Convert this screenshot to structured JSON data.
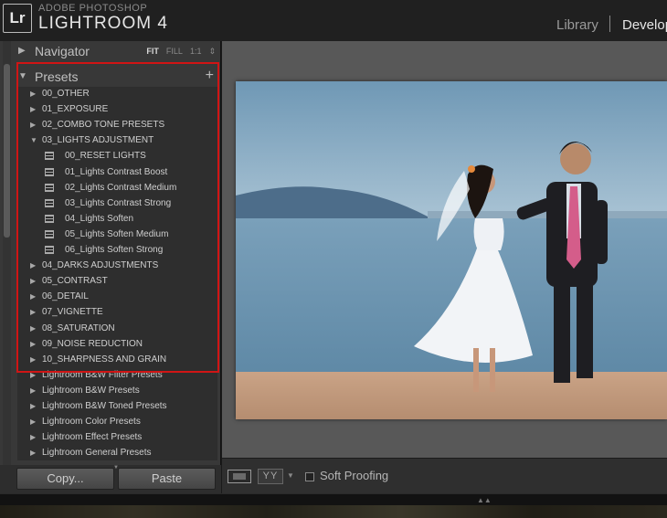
{
  "app": {
    "logo": "Lr",
    "subtitle": "ADOBE PHOTOSHOP",
    "title": "LIGHTROOM 4"
  },
  "modules": {
    "library": "Library",
    "develop": "Develop"
  },
  "navigator": {
    "label": "Navigator",
    "options": [
      "FIT",
      "FILL",
      "1:1"
    ],
    "stepper": "⇕"
  },
  "presets": {
    "label": "Presets",
    "add": "+",
    "folders": [
      {
        "label": "00_OTHER",
        "expanded": false
      },
      {
        "label": "01_EXPOSURE",
        "expanded": false
      },
      {
        "label": "02_COMBO TONE PRESETS",
        "expanded": false
      },
      {
        "label": "03_LIGHTS ADJUSTMENT",
        "expanded": true,
        "children": [
          "00_RESET LIGHTS",
          "01_Lights Contrast Boost",
          "02_Lights Contrast Medium",
          "03_Lights Contrast Strong",
          "04_Lights Soften",
          "05_Lights Soften Medium",
          "06_Lights Soften Strong"
        ]
      },
      {
        "label": "04_DARKS ADJUSTMENTS",
        "expanded": false
      },
      {
        "label": "05_CONTRAST",
        "expanded": false
      },
      {
        "label": "06_DETAIL",
        "expanded": false
      },
      {
        "label": "07_VIGNETTE",
        "expanded": false
      },
      {
        "label": "08_SATURATION",
        "expanded": false
      },
      {
        "label": "09_NOISE REDUCTION",
        "expanded": false
      },
      {
        "label": "10_SHARPNESS AND GRAIN",
        "expanded": false
      },
      {
        "label": "Lightroom B&W Filter Presets",
        "expanded": false
      },
      {
        "label": "Lightroom B&W Presets",
        "expanded": false
      },
      {
        "label": "Lightroom B&W Toned Presets",
        "expanded": false
      },
      {
        "label": "Lightroom Color Presets",
        "expanded": false
      },
      {
        "label": "Lightroom Effect Presets",
        "expanded": false
      },
      {
        "label": "Lightroom General Presets",
        "expanded": false
      }
    ]
  },
  "buttons": {
    "copy": "Copy...",
    "paste": "Paste"
  },
  "toolbar": {
    "yy": "YY",
    "soft_proofing": "Soft Proofing"
  },
  "colors": {
    "highlight": "#d01515"
  },
  "icons": {
    "expand": "triangle-right-icon",
    "collapse": "triangle-down-icon",
    "preset": "preset-list-icon"
  }
}
